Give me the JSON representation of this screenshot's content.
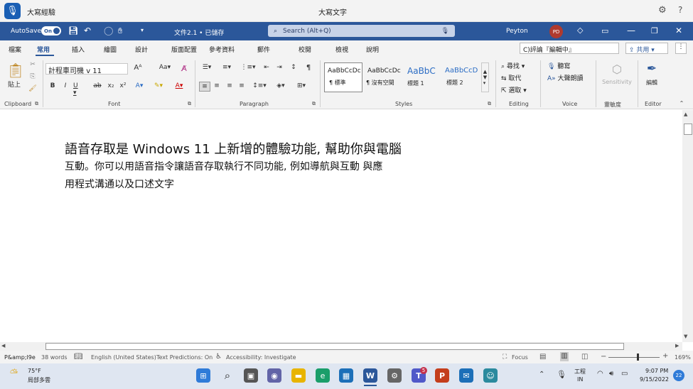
{
  "topbar": {
    "app_title": "大寫經驗",
    "center_title": "大寫文字"
  },
  "titlebar": {
    "autosave_label": "AutoSave",
    "autosave_state": "On",
    "doc_name": "文件2.1 • 已儲存",
    "search_placeholder": "Search (Alt+Q)",
    "user_name": "Peyton",
    "avatar_initials": "PD"
  },
  "tabs": [
    "檔案",
    "常用",
    "插入",
    "繪圖",
    "設計",
    "版面配置",
    "參考資料",
    "郵件",
    "校閱",
    "檢視",
    "說明"
  ],
  "comments_label": "C)評論『編輯中』",
  "share_label": "共用",
  "ribbon": {
    "paste_label": "貼上",
    "clipboard_group": "Clipboard",
    "font_name": "計程車司機",
    "font_size": "v 11",
    "font_group": "Font",
    "paragraph_group": "Paragraph",
    "styles": [
      {
        "preview": "AaBbCcDc",
        "name": "¶ 標準"
      },
      {
        "preview": "AaBbCcDc",
        "name": "¶ 沒有空間"
      },
      {
        "preview": "AaBbC",
        "name": "標題 1"
      },
      {
        "preview": "AaBbCcD",
        "name": "標題 2"
      }
    ],
    "styles_group": "Styles",
    "find_label": "尋找",
    "replace_label": "取代",
    "select_label": "選取",
    "editing_group": "Editing",
    "dictate_label": "聽寫",
    "read_aloud_label": "大聲朗讀",
    "voice_group": "Voice",
    "sensitivity_label": "Sensitivity",
    "sensitivity_group": "靈敏度",
    "editor_label": "編輯",
    "editor_group": "Editor"
  },
  "document": {
    "line1": "語音存取是 Windows 11 上新增的體驗功能, 幫助你與電腦",
    "line2": "互動。你可以用語音指令讓語音存取執行不同功能, 例如導航與互動  與應",
    "line3": "用程式溝通以及口述文字"
  },
  "status": {
    "page": "P&amp;l9e",
    "words": "38 words",
    "language": "English (United States)",
    "text_predictions": "Text Predictions: On",
    "accessibility": "Accessibility: Investigate",
    "focus": "Focus",
    "zoom": "169%"
  },
  "taskbar": {
    "temp": "75°F",
    "weather": "局部多雲",
    "ime_top": "工程",
    "ime_bottom": "IN",
    "time": "9:07 PM",
    "date": "9/15/2022",
    "notif_count": "22",
    "teams_badge": "5"
  }
}
